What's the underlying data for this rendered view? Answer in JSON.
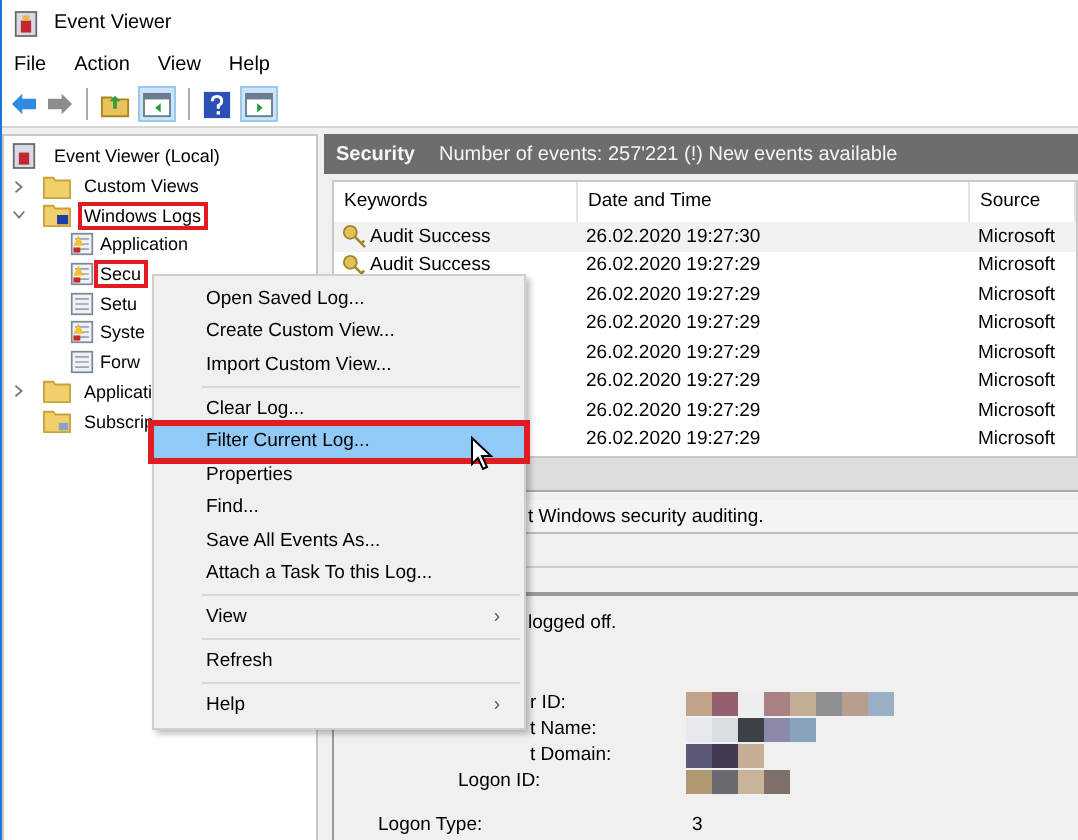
{
  "window": {
    "title": "Event Viewer"
  },
  "menu": [
    "File",
    "Action",
    "View",
    "Help"
  ],
  "tree": {
    "label": "Event Viewer (Local)",
    "kind": "computer",
    "children": [
      {
        "label": "Custom Views",
        "kind": "folder",
        "expanded": false,
        "highlighted": false
      },
      {
        "label": "Windows Logs",
        "kind": "logs-folder",
        "expanded": true,
        "highlighted": true,
        "children": [
          {
            "label": "Application",
            "kind": "log-warning",
            "highlighted": false
          },
          {
            "label": "Secu",
            "kind": "log-warning",
            "highlighted": true
          },
          {
            "label": "Setu",
            "kind": "log",
            "highlighted": false
          },
          {
            "label": "Syste",
            "kind": "log-warning",
            "highlighted": false
          },
          {
            "label": "Forw",
            "kind": "log",
            "highlighted": false
          }
        ]
      },
      {
        "label": "Applicati",
        "kind": "folder",
        "expanded": false,
        "highlighted": false
      },
      {
        "label": "Subscrip",
        "kind": "subscriptions",
        "highlighted": false
      }
    ]
  },
  "log_header": {
    "title": "Security",
    "info": "Number of events: 257'221 (!) New events available"
  },
  "table": {
    "columns": [
      "Keywords",
      "Date and Time",
      "Source"
    ],
    "rows": [
      {
        "keywords": "Audit Success",
        "date": "26.02.2020 19:27:30",
        "source": "Microsoft",
        "selected": true
      },
      {
        "keywords": "Audit Success",
        "date": "26.02.2020 19:27:29",
        "source": "Microsoft",
        "selected": false
      },
      {
        "date": "26.02.2020 19:27:29",
        "source": "Microsoft",
        "selected": false
      },
      {
        "date": "26.02.2020 19:27:29",
        "source": "Microsoft",
        "selected": false
      },
      {
        "date": "26.02.2020 19:27:29",
        "source": "Microsoft",
        "selected": false
      },
      {
        "date": "26.02.2020 19:27:29",
        "source": "Microsoft",
        "selected": false
      },
      {
        "date": "26.02.2020 19:27:29",
        "source": "Microsoft",
        "selected": false
      },
      {
        "date": "26.02.2020 19:27:29",
        "source": "Microsoft",
        "selected": false
      }
    ]
  },
  "detail": {
    "title": "t Windows security auditing.",
    "summary": "logged off.",
    "fields": [
      {
        "label": "r ID:",
        "cut": true,
        "redacted": true
      },
      {
        "label": "t Name:",
        "cut": true,
        "redacted": true
      },
      {
        "label": "t Domain:",
        "cut": true,
        "redacted": true
      },
      {
        "label": "Logon ID:",
        "cut": false,
        "redacted": true
      }
    ],
    "logon_type": {
      "label": "Logon Type:",
      "value": "3"
    }
  },
  "context_menu": [
    [
      {
        "label": "Open Saved Log...",
        "selected": false,
        "highlighted": false
      },
      {
        "label": "Create Custom View...",
        "selected": false,
        "highlighted": false
      },
      {
        "label": "Import Custom View...",
        "selected": false,
        "highlighted": false
      }
    ],
    [
      {
        "label": "Clear Log...",
        "selected": false,
        "highlighted": false
      },
      {
        "label": "Filter Current Log...",
        "selected": true,
        "highlighted": true
      },
      {
        "label": "Properties",
        "selected": false,
        "highlighted": false
      },
      {
        "label": "Find...",
        "selected": false,
        "highlighted": false
      },
      {
        "label": "Save All Events As...",
        "selected": false,
        "highlighted": false
      },
      {
        "label": "Attach a Task To this Log...",
        "selected": false,
        "highlighted": false
      }
    ],
    [
      {
        "label": "View",
        "arrow": "›",
        "selected": false,
        "highlighted": false
      }
    ],
    [
      {
        "label": "Refresh",
        "selected": false,
        "highlighted": false
      }
    ],
    [
      {
        "label": "Help",
        "arrow": "›",
        "selected": false,
        "highlighted": false
      }
    ]
  ]
}
